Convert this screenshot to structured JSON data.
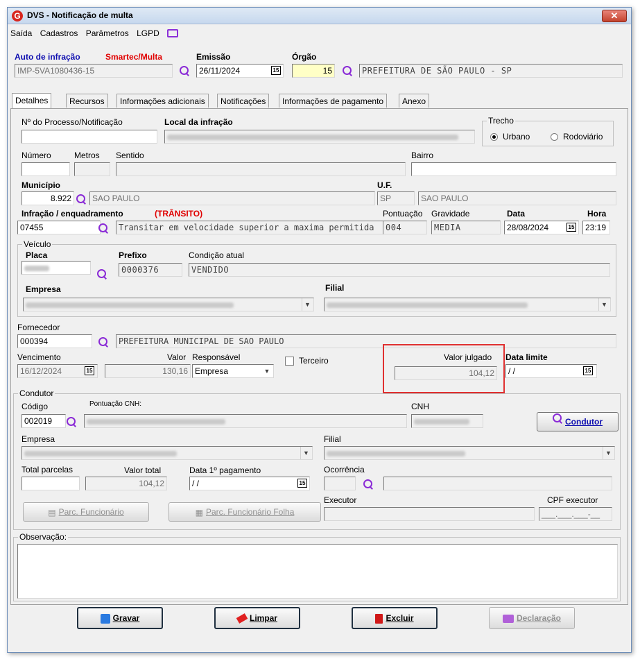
{
  "window": {
    "title": "DVS - Notificação de multa",
    "close_label": "✕"
  },
  "menu": {
    "items": [
      "Saída",
      "Cadastros",
      "Parâmetros",
      "LGPD"
    ]
  },
  "header": {
    "auto_label": "Auto de infração",
    "auto_source": "Smartec/Multa",
    "auto_value": "IMP-5VA1080436-15",
    "emissao_label": "Emissão",
    "emissao_value": "26/11/2024",
    "orgao_label": "Órgão",
    "orgao_code": "15",
    "orgao_name": "PREFEITURA DE SÃO PAULO - SP"
  },
  "tabs": [
    "Detalhes",
    "Recursos",
    "Informações adicionais",
    "Notificações",
    "Informações de pagamento",
    "Anexo"
  ],
  "details": {
    "processo_label": "Nº do Processo/Notificação",
    "processo_value": "",
    "local_label": "Local da infração",
    "trecho_label": "Trecho",
    "trecho_urbano": "Urbano",
    "trecho_rodoviario": "Rodoviário",
    "numero_label": "Número",
    "metros_label": "Metros",
    "sentido_label": "Sentido",
    "bairro_label": "Bairro",
    "municipio_label": "Município",
    "municipio_code": "8.922",
    "municipio_name": "SAO PAULO",
    "uf_label": "U.F.",
    "uf_code": "SP",
    "uf_name": "SAO PAULO",
    "infracao_label": "Infração / enquadramento",
    "infracao_tag": "(TRÂNSITO)",
    "infracao_code": "07455",
    "infracao_desc": "Transitar em velocidade superior a maxima permitida",
    "pontuacao_label": "Pontuação",
    "pontuacao_value": "004",
    "gravidade_label": "Gravidade",
    "gravidade_value": "MEDIA",
    "data_label": "Data",
    "data_value": "28/08/2024",
    "hora_label": "Hora",
    "hora_value": "23:19"
  },
  "veiculo": {
    "group_label": "Veículo",
    "placa_label": "Placa",
    "prefixo_label": "Prefixo",
    "prefixo_value": "0000376",
    "condicao_label": "Condição atual",
    "condicao_value": "VENDIDO",
    "empresa_label": "Empresa",
    "filial_label": "Filial"
  },
  "fornecedor": {
    "label": "Fornecedor",
    "code": "000394",
    "name": "PREFEITURA MUNICIPAL DE SAO PAULO",
    "vencimento_label": "Vencimento",
    "vencimento_value": "16/12/2024",
    "valor_label": "Valor",
    "valor_value": "130,16",
    "responsavel_label": "Responsável",
    "responsavel_value": "Empresa",
    "terceiro_label": "Terceiro",
    "valor_julgado_label": "Valor julgado",
    "valor_julgado_value": "104,12",
    "data_limite_label": "Data limite",
    "data_limite_value": "/ /"
  },
  "condutor": {
    "group_label": "Condutor",
    "codigo_label": "Código",
    "pontuacao_cnh_label": "Pontuação CNH:",
    "codigo_value": "002019",
    "cnh_label": "CNH",
    "condutor_button": "Condutor",
    "empresa_label": "Empresa",
    "filial_label": "Filial",
    "total_parcelas_label": "Total parcelas",
    "valor_total_label": "Valor total",
    "valor_total_value": "104,12",
    "data_pagamento_label": "Data 1º pagamento",
    "data_pagamento_value": "/ /",
    "ocorrencia_label": "Ocorrência",
    "executor_label": "Executor",
    "cpf_label": "CPF executor",
    "cpf_value": "___.___.___-__",
    "parc_func_button": "Parc. Funcionário",
    "parc_func_folha_button": "Parc. Funcionário Folha"
  },
  "observacao": {
    "label": "Observação:"
  },
  "actions": {
    "gravar": "Gravar",
    "limpar": "Limpar",
    "excluir": "Excluir",
    "declaracao": "Declaração"
  },
  "colors": {
    "accent_blue": "#1010b0",
    "accent_red": "#e00000",
    "search_purple": "#8a2ad6",
    "highlight_red": "#e03030"
  }
}
